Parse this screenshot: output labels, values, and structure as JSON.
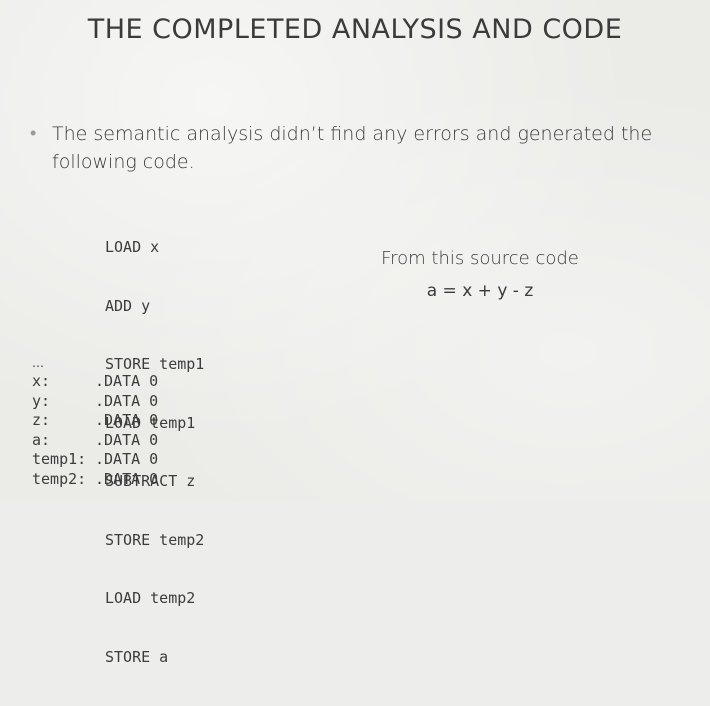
{
  "slide": {
    "title": "THE COMPLETED ANALYSIS AND CODE",
    "bullet": {
      "marker": "•",
      "text": "The semantic analysis didn’t find any errors and generated the following code."
    },
    "code_lines": [
      "LOAD x",
      "ADD y",
      "STORE temp1",
      "LOAD temp1",
      "SUBTRACT z",
      "STORE temp2",
      "LOAD temp2",
      "STORE a"
    ],
    "ellipsis": "…",
    "data_rows": [
      {
        "label": "x:",
        "value": ".DATA 0"
      },
      {
        "label": "y:",
        "value": ".DATA 0"
      },
      {
        "label": "z:",
        "value": ".DATA 0"
      },
      {
        "label": "a:",
        "value": ".DATA 0"
      },
      {
        "label": "temp1:",
        "value": ".DATA 0"
      },
      {
        "label": "temp2:",
        "value": ".DATA 0"
      }
    ],
    "source": {
      "label": "From this source code",
      "expression": "a = x + y - z"
    }
  }
}
